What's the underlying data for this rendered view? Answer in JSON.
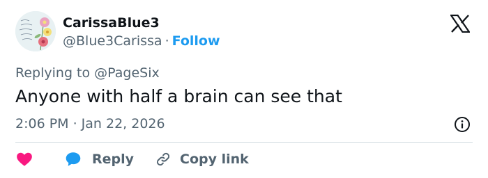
{
  "author": {
    "display_name": "CarissaBlue3",
    "handle": "@Blue3Carissa",
    "separator": "·",
    "follow_label": "Follow"
  },
  "reply_context": {
    "prefix": "Replying to ",
    "mention": "@PageSix"
  },
  "tweet": {
    "text": "Anyone with half a brain can see that",
    "timestamp": "2:06 PM · Jan 22, 2026"
  },
  "actions": {
    "reply_label": "Reply",
    "copy_link_label": "Copy link"
  },
  "icons": {
    "brand": "x-logo-icon",
    "info": "info-icon",
    "like": "heart-icon",
    "reply": "reply-bubble-icon",
    "copy": "link-icon"
  },
  "colors": {
    "accent": "#1d9bf0",
    "like": "#f91880",
    "text": "#0f1419",
    "muted": "#536471",
    "divider": "#cfd9de"
  }
}
